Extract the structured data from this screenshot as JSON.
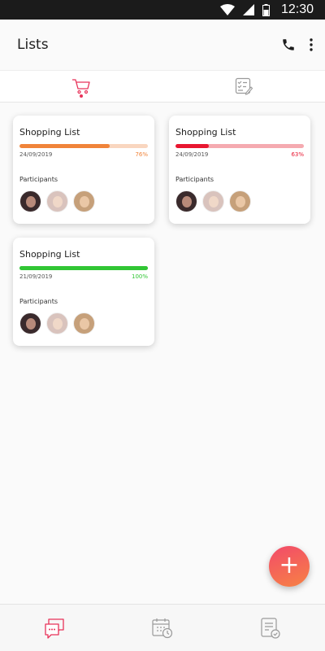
{
  "status_bar": {
    "time": "12:30"
  },
  "app_bar": {
    "title": "Lists"
  },
  "tabs": [
    {
      "name": "shopping",
      "active": true
    },
    {
      "name": "checklist",
      "active": false
    }
  ],
  "cards": [
    {
      "title": "Shopping List",
      "date": "24/09/2019",
      "percent_label": "76%",
      "progress": 0.7,
      "fill_color": "#f0843a",
      "track_color": "#f9d6bf",
      "pct_color": "#f0843a",
      "participants_label": "Participants"
    },
    {
      "title": "Shopping List",
      "date": "24/09/2019",
      "percent_label": "63%",
      "progress": 0.26,
      "fill_color": "#e81630",
      "track_color": "#f5aab0",
      "pct_color": "#e81630",
      "participants_label": "Participants"
    },
    {
      "title": "Shopping List",
      "date": "21/09/2019",
      "percent_label": "100%",
      "progress": 1.0,
      "fill_color": "#31c634",
      "track_color": "#31c634",
      "pct_color": "#31c634",
      "participants_label": "Participants"
    }
  ],
  "fab": {
    "label": "+"
  },
  "bottom_nav": [
    {
      "name": "chat",
      "active": true
    },
    {
      "name": "calendar",
      "active": false
    },
    {
      "name": "tasks",
      "active": false
    }
  ],
  "colors": {
    "accent": "#e8335a",
    "icon_gray": "#9a9a9a"
  }
}
